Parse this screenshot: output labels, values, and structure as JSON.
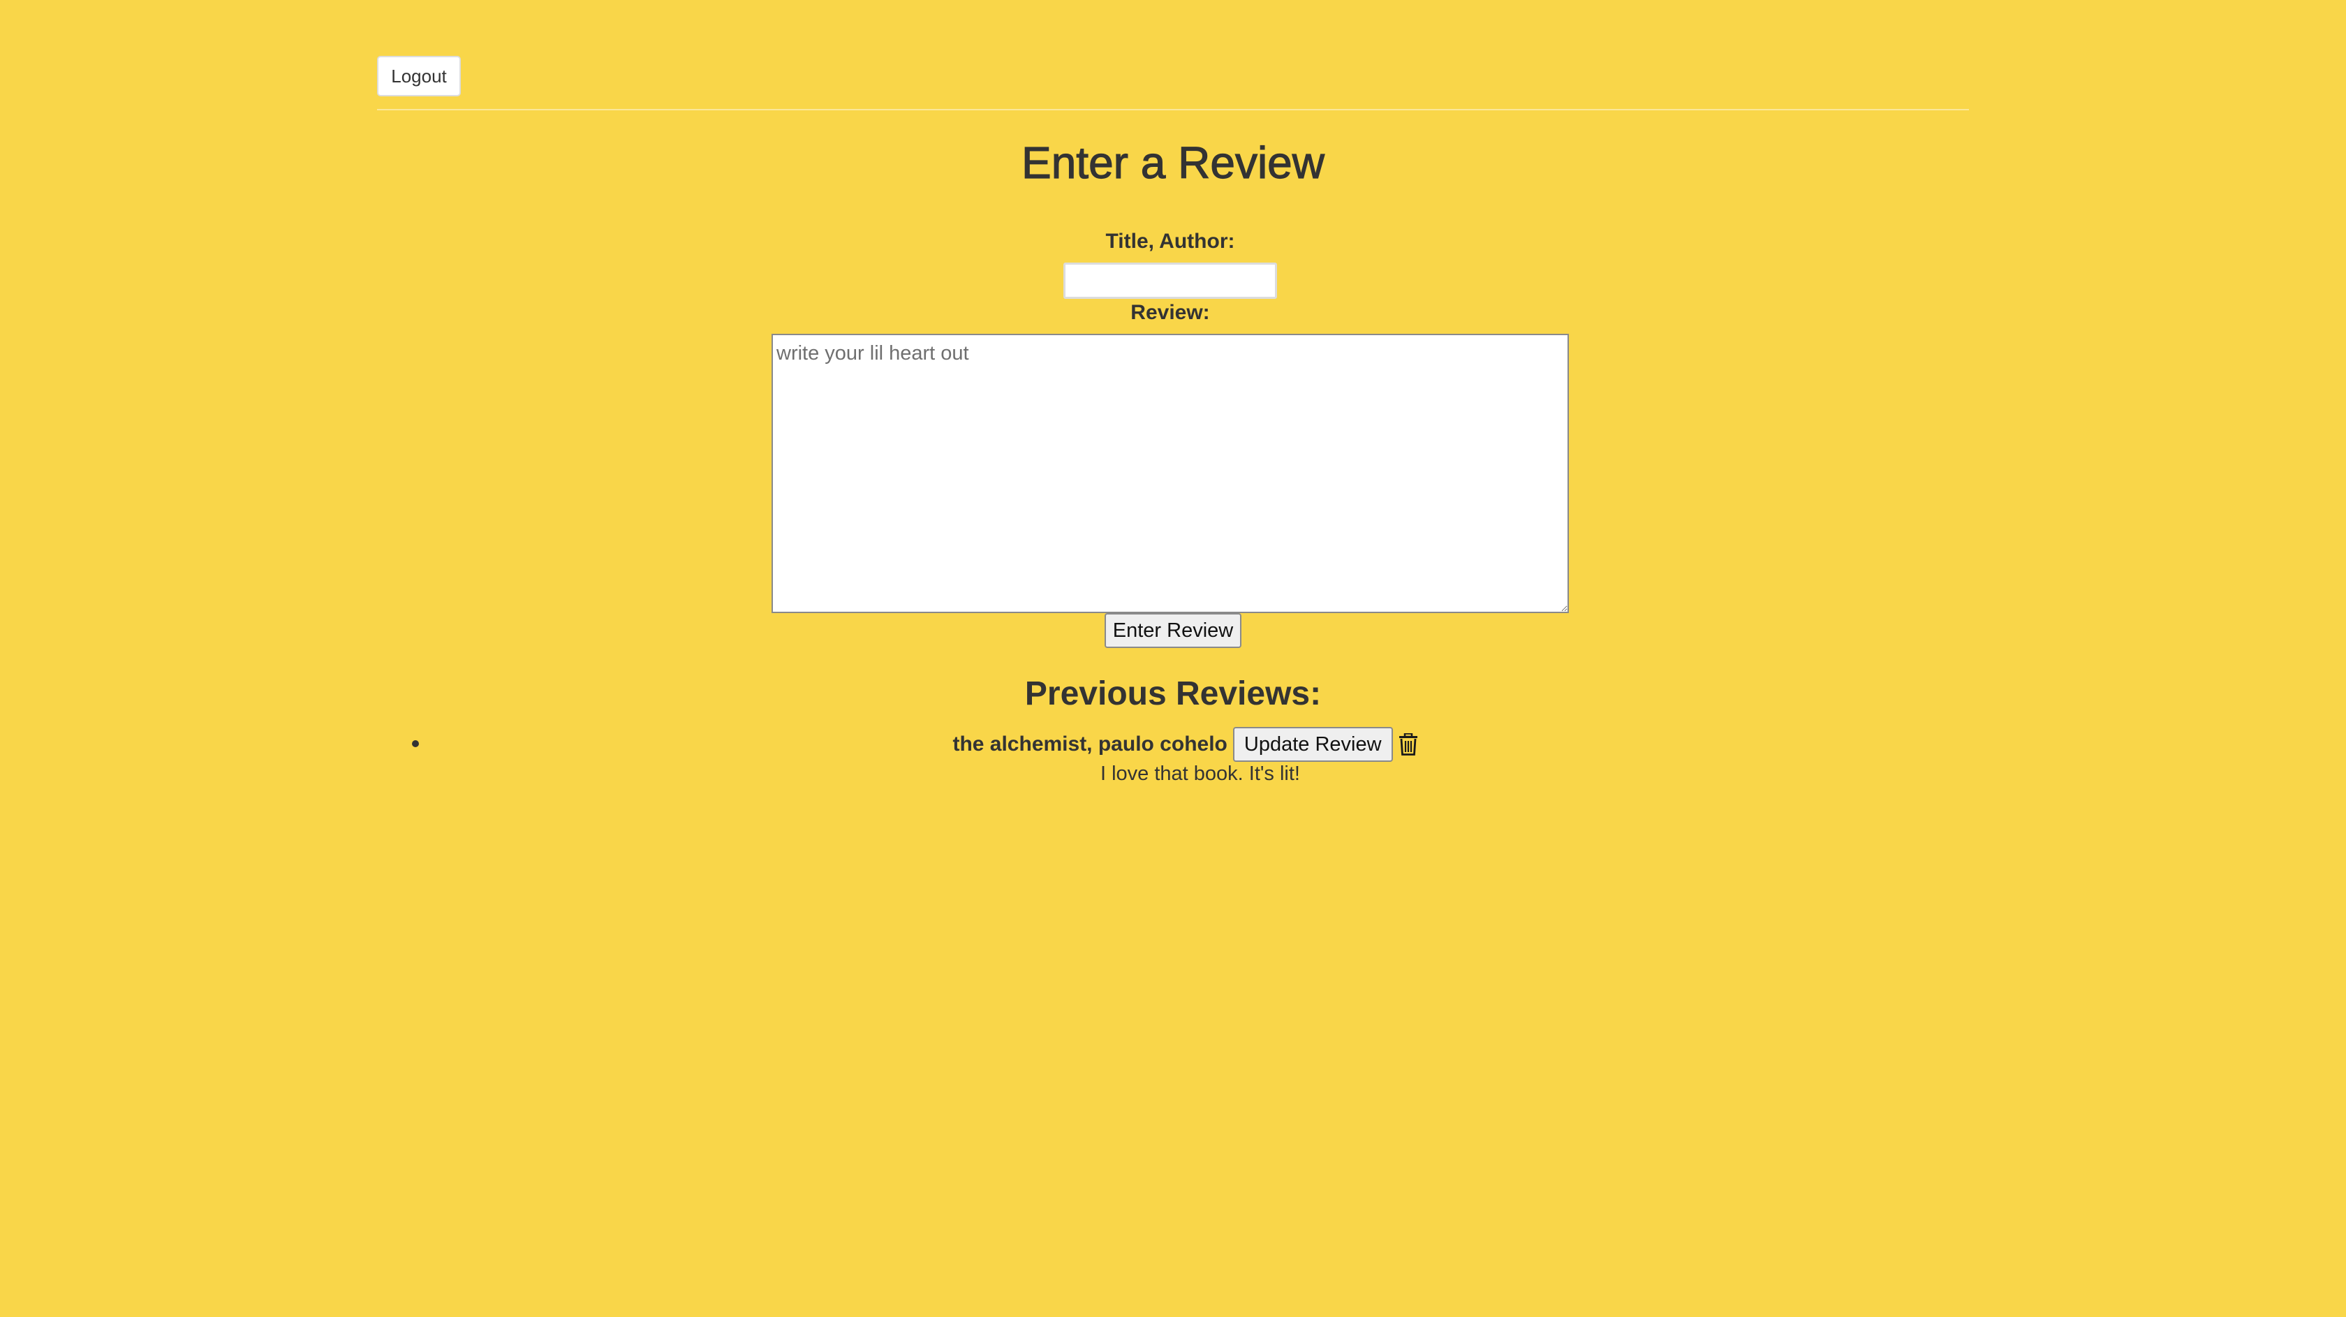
{
  "header": {
    "logout_label": "Logout"
  },
  "form": {
    "heading": "Enter a Review",
    "title_author_label": "Title, Author:",
    "title_author_value": "",
    "review_label": "Review:",
    "review_placeholder": "write your lil heart out",
    "submit_label": "Enter Review"
  },
  "previous": {
    "heading": "Previous Reviews:",
    "reviews": [
      {
        "title_author": "the alchemist, paulo cohelo",
        "update_label": "Update Review",
        "delete_icon": "trash-icon",
        "text": "I love that book. It's lit!"
      }
    ]
  },
  "colors": {
    "background": "#f9d649",
    "text": "#333333"
  }
}
